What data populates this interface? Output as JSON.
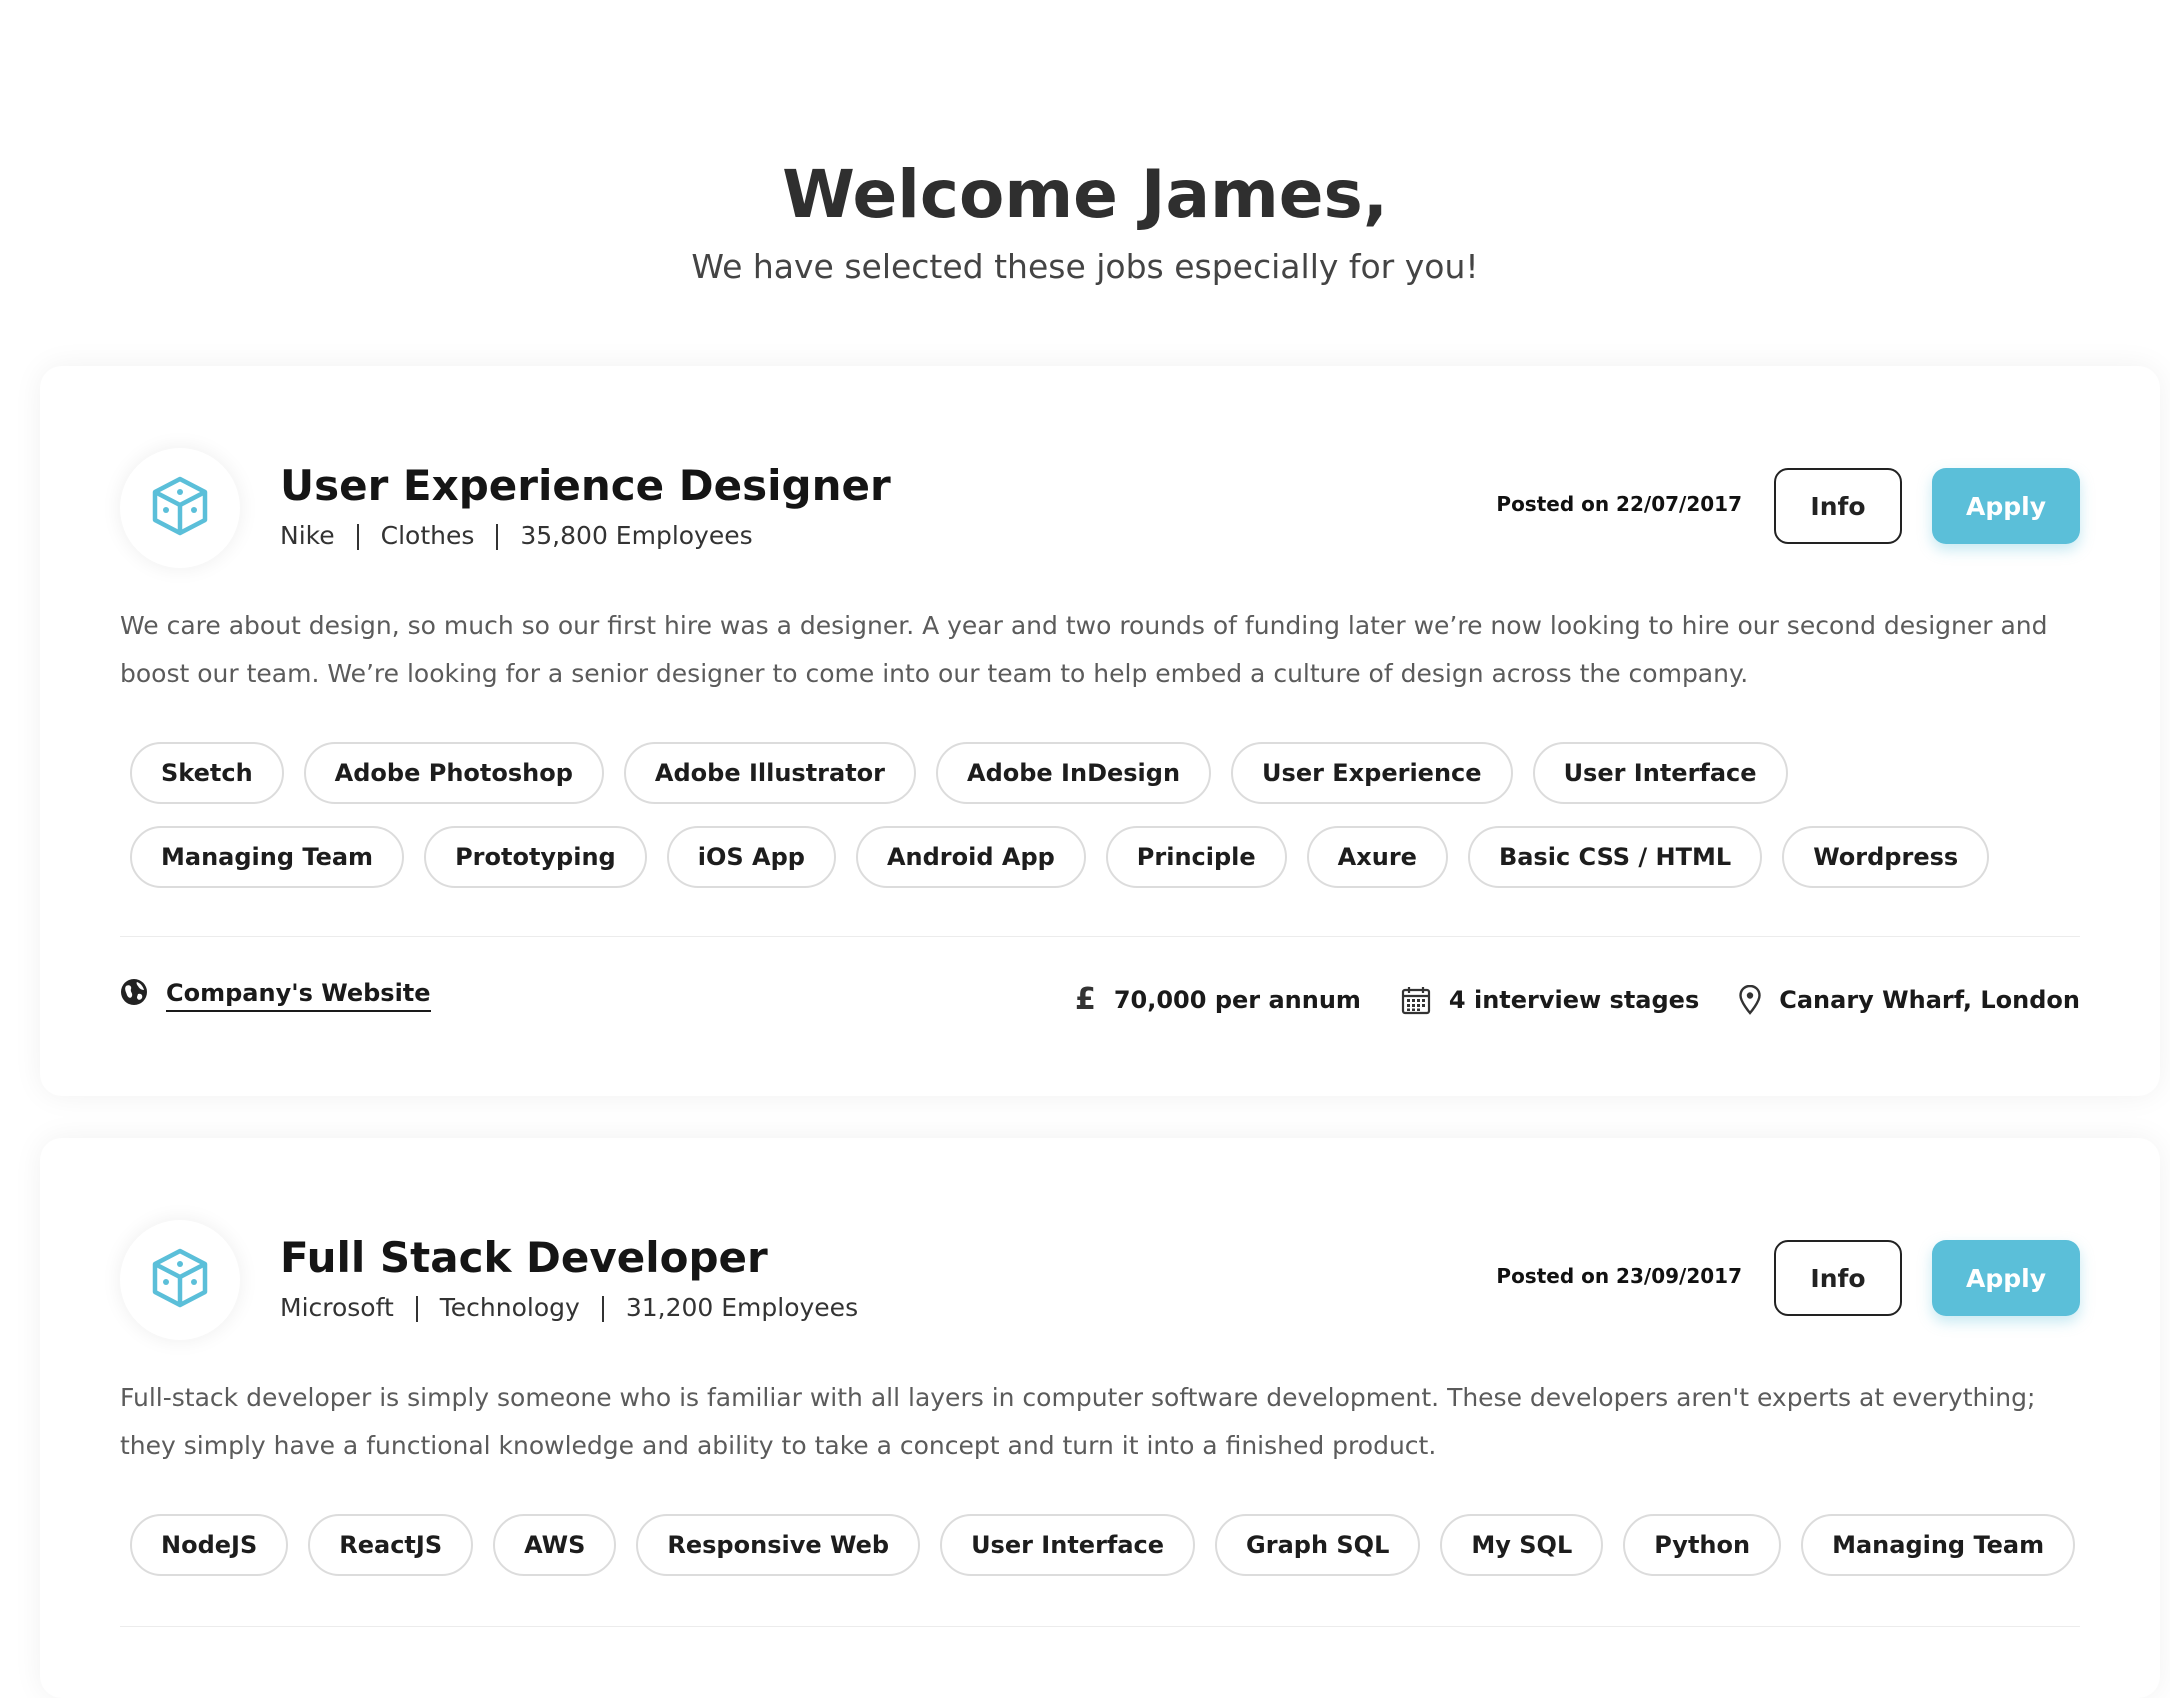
{
  "header": {
    "title": "Welcome James,",
    "subtitle": "We have selected these jobs especially for you!"
  },
  "colors": {
    "accent": "#5bbfd9",
    "text": "#222222",
    "tag_border": "#dcdcdc"
  },
  "jobs": [
    {
      "logo_icon": "cube-icon",
      "title": "User Experience Designer",
      "company": "Nike",
      "industry": "Clothes",
      "employees": "35,800 Employees",
      "posted": "Posted on 22/07/2017",
      "info_label": "Info",
      "apply_label": "Apply",
      "description": "We care about design, so much so our first hire was a designer. A year and two rounds of funding later we’re now looking to hire our second designer and boost our team. We’re looking for a senior designer to come into our team to help embed a culture of design across the company.",
      "tags": [
        "Sketch",
        "Adobe Photoshop",
        "Adobe Illustrator",
        "Adobe InDesign",
        "User Experience",
        "User Interface",
        "Managing Team",
        "Prototyping",
        "iOS App",
        "Android App",
        "Principle",
        "Axure",
        "Basic CSS / HTML",
        "Wordpress"
      ],
      "website_label": "Company's Website",
      "salary": "70,000 per annum",
      "salary_symbol": "£",
      "interview_stages": "4 interview stages",
      "location": "Canary Wharf, London"
    },
    {
      "logo_icon": "cube-icon",
      "title": "Full Stack Developer",
      "company": "Microsoft",
      "industry": "Technology",
      "employees": "31,200 Employees",
      "posted": "Posted on 23/09/2017",
      "info_label": "Info",
      "apply_label": "Apply",
      "description": "Full-stack developer is simply someone who is familiar with all layers in computer software development. These developers aren't experts at everything; they simply have a functional knowledge and ability to take a concept and turn it into a finished product.",
      "tags": [
        "NodeJS",
        "ReactJS",
        "AWS",
        "Responsive Web",
        "User Interface",
        "Graph SQL",
        "My SQL",
        "Python",
        "Managing Team"
      ]
    }
  ]
}
